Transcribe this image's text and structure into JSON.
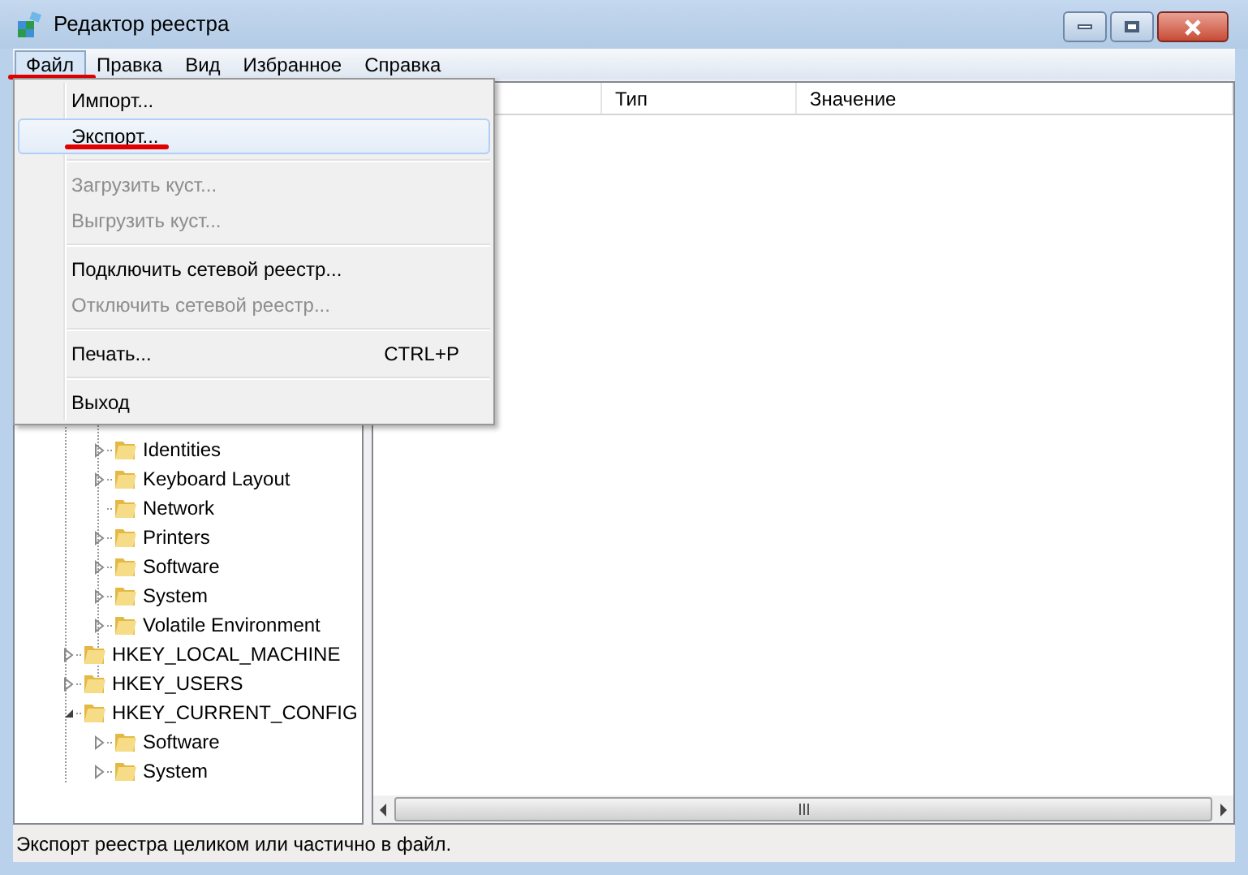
{
  "window": {
    "title": "Редактор реестра"
  },
  "menu_bar": [
    {
      "label": "Файл",
      "selected": true
    },
    {
      "label": "Правка",
      "selected": false
    },
    {
      "label": "Вид",
      "selected": false
    },
    {
      "label": "Избранное",
      "selected": false
    },
    {
      "label": "Справка",
      "selected": false
    }
  ],
  "file_menu": [
    {
      "kind": "item",
      "label": "Импорт...",
      "selected": false,
      "disabled": false
    },
    {
      "kind": "item",
      "label": "Экспорт...",
      "selected": true,
      "disabled": false
    },
    {
      "kind": "separator"
    },
    {
      "kind": "item",
      "label": "Загрузить куст...",
      "selected": false,
      "disabled": true
    },
    {
      "kind": "item",
      "label": "Выгрузить куст...",
      "selected": false,
      "disabled": true
    },
    {
      "kind": "separator"
    },
    {
      "kind": "item",
      "label": "Подключить сетевой реестр...",
      "selected": false,
      "disabled": false
    },
    {
      "kind": "item",
      "label": "Отключить сетевой реестр...",
      "selected": false,
      "disabled": true
    },
    {
      "kind": "separator"
    },
    {
      "kind": "item",
      "label": "Печать...",
      "shortcut": "CTRL+P",
      "selected": false,
      "disabled": false
    },
    {
      "kind": "separator"
    },
    {
      "kind": "item",
      "label": "Выход",
      "selected": false,
      "disabled": false
    }
  ],
  "tree": {
    "partial_branch": [
      {
        "label": "Identities",
        "expanded": false
      },
      {
        "label": "Keyboard Layout",
        "expanded": false
      },
      {
        "label": "Network"
      },
      {
        "label": "Printers",
        "expanded": false
      },
      {
        "label": "Software",
        "expanded": false
      },
      {
        "label": "System",
        "expanded": false
      },
      {
        "label": "Volatile Environment",
        "expanded": false
      }
    ],
    "roots": [
      {
        "label": "HKEY_LOCAL_MACHINE",
        "expanded": false
      },
      {
        "label": "HKEY_USERS",
        "expanded": false
      },
      {
        "label": "HKEY_CURRENT_CONFIG",
        "expanded": true,
        "children": [
          {
            "label": "Software",
            "expanded": false
          },
          {
            "label": "System",
            "expanded": false
          }
        ]
      }
    ]
  },
  "list": {
    "columns": [
      "Тип",
      "Значение"
    ]
  },
  "status_bar": "Экспорт реестра целиком или частично в файл."
}
